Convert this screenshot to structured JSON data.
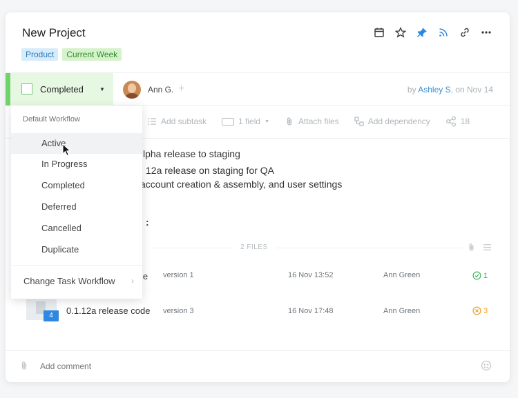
{
  "task": {
    "title": "New Project",
    "tags": [
      {
        "label": "Product",
        "color": "#d6ecfb"
      },
      {
        "label": "Current Week",
        "color": "#d5f2cb"
      }
    ]
  },
  "header_icons": [
    "calendar-icon",
    "star-icon",
    "pin-icon",
    "rss-icon",
    "link-icon",
    "more-icon"
  ],
  "status": {
    "label": "Completed",
    "accent_color": "#6fd36b"
  },
  "assignee": {
    "name": "Ann G.",
    "add_symbol": "+"
  },
  "author_line": {
    "prefix": "by",
    "author": "Ashley S.",
    "suffix": "on Nov 14"
  },
  "actions": {
    "add_subtask": "Add subtask",
    "field": "1 field",
    "attach_files": "Attach files",
    "add_dependency": "Add dependency",
    "share_count": "18"
  },
  "description": {
    "line1": "lpha release to staging",
    "line2": "12a release on staging for QA",
    "line3": "account creation & assembly, and user settings",
    "line4": ":"
  },
  "files": {
    "count_label": "2 FILES",
    "rows": [
      {
        "name": "le",
        "version": "version 1",
        "date": "16 Nov 13:52",
        "author": "Ann Green",
        "status_count": "1",
        "status": "approved",
        "status_color": "#3db85a"
      },
      {
        "name": "0.1.12a release code",
        "version": "version 3",
        "date": "16 Nov 17:48",
        "author": "Ann Green",
        "status_count": "3",
        "status": "rejected",
        "status_color": "#f0a020",
        "badge": "4"
      }
    ]
  },
  "comment": {
    "placeholder": "Add comment"
  },
  "dropdown": {
    "header": "Default Workflow",
    "items": [
      "Active",
      "In Progress",
      "Completed",
      "Deferred",
      "Cancelled",
      "Duplicate"
    ],
    "hovered_item": "Active",
    "change_label": "Change Task Workflow"
  }
}
